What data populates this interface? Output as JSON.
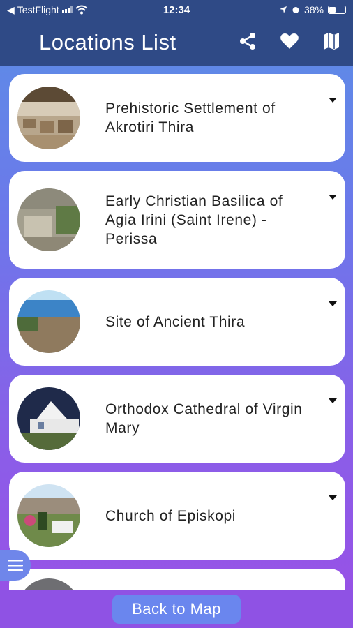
{
  "status_bar": {
    "carrier": "TestFlight",
    "time": "12:34",
    "battery": "38%",
    "battery_level": 0.38
  },
  "header": {
    "title": "Locations List",
    "actions": [
      {
        "icon": "share-icon"
      },
      {
        "icon": "heart-icon"
      },
      {
        "icon": "map-icon"
      }
    ]
  },
  "locations": [
    {
      "name": "Prehistoric Settlement of Akrotiri Thira",
      "thumb": "archaeological-site-photo"
    },
    {
      "name": "Early Christian Basilica of Agia Irini (Saint Irene) - Perissa",
      "thumb": "ruins-photo"
    },
    {
      "name": "Site of Ancient Thira",
      "thumb": "coastal-ruins-photo"
    },
    {
      "name": "Orthodox Cathedral of Virgin Mary",
      "thumb": "cathedral-photo"
    },
    {
      "name": "Church of Episkopi",
      "thumb": "church-photo"
    }
  ],
  "footer": {
    "back_label": "Back to Map"
  },
  "colors": {
    "header": "#2f4a86",
    "gradient_top": "#5b8fe6",
    "gradient_bottom": "#9a4fe6",
    "button": "#6a86ee"
  }
}
